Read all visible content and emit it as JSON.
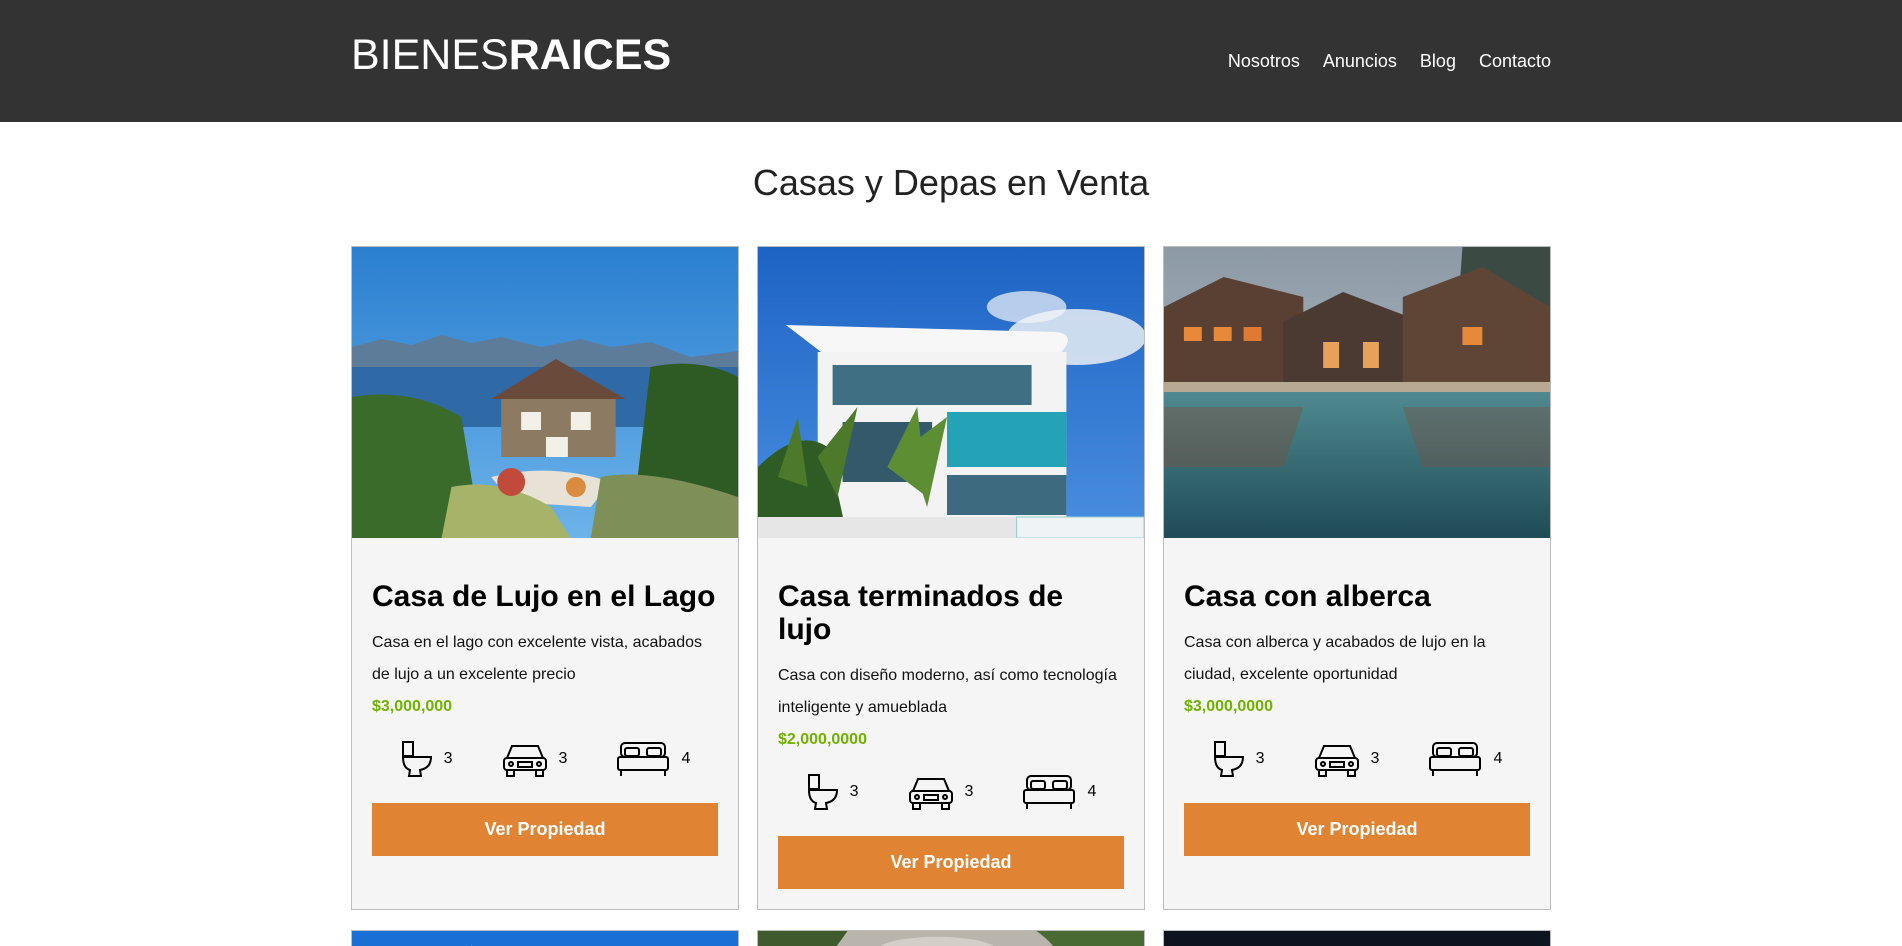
{
  "header": {
    "logo_light": "BIENES",
    "logo_bold": "RAICES",
    "nav": [
      "Nosotros",
      "Anuncios",
      "Blog",
      "Contacto"
    ]
  },
  "main": {
    "title": "Casas y Depas en Venta",
    "cards": [
      {
        "title": "Casa de Lujo en el Lago",
        "description": "Casa en el lago con excelente vista, acabados de lujo a un excelente precio",
        "price": "$3,000,000",
        "bathrooms": "3",
        "parking": "3",
        "bedrooms": "4",
        "button": "Ver Propiedad"
      },
      {
        "title": "Casa terminados de lujo",
        "description": "Casa con diseño moderno, así como tecnología inteligente y amueblada",
        "price": "$2,000,0000",
        "bathrooms": "3",
        "parking": "3",
        "bedrooms": "4",
        "button": "Ver Propiedad"
      },
      {
        "title": "Casa con alberca",
        "description": "Casa con alberca y acabados de lujo en la ciudad, excelente oportunidad",
        "price": "$3,000,0000",
        "bathrooms": "3",
        "parking": "3",
        "bedrooms": "4",
        "button": "Ver Propiedad"
      }
    ]
  },
  "colors": {
    "header_bg": "#333333",
    "accent_orange": "#e08332",
    "price_green": "#71b100",
    "card_bg": "#f5f5f5"
  },
  "icons": {
    "bathroom": "toilet-icon",
    "parking": "car-icon",
    "bedroom": "bed-icon"
  }
}
